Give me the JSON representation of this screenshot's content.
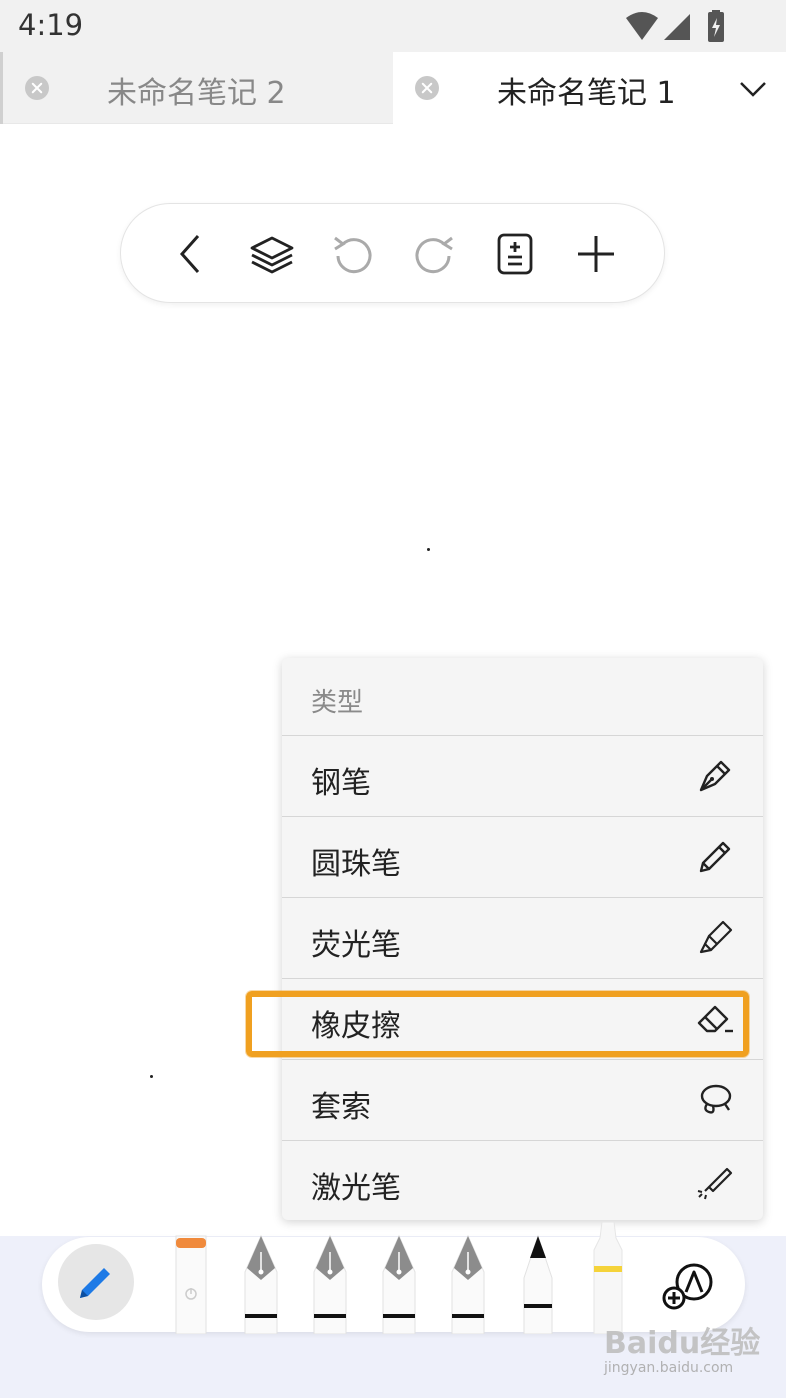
{
  "status_bar": {
    "time": "4:19"
  },
  "tabs": [
    {
      "title": "未命名笔记 2",
      "active": false
    },
    {
      "title": "未命名笔记 1",
      "active": true
    }
  ],
  "toolbar": {
    "icons": [
      "back-icon",
      "layers-icon",
      "undo-icon",
      "redo-icon",
      "page-add-icon",
      "plus-icon"
    ]
  },
  "menu": {
    "header": "类型",
    "items": [
      {
        "label": "钢笔",
        "icon": "fountain-pen-icon"
      },
      {
        "label": "圆珠笔",
        "icon": "pencil-icon"
      },
      {
        "label": "荧光笔",
        "icon": "highlighter-icon"
      },
      {
        "label": "橡皮擦",
        "icon": "eraser-icon",
        "highlighted": true
      },
      {
        "label": "套索",
        "icon": "lasso-icon"
      },
      {
        "label": "激光笔",
        "icon": "laser-pen-icon"
      }
    ]
  },
  "pen_tray": {
    "tools": [
      "eraser-stick-icon",
      "fountain-pen-icon",
      "fountain-pen-icon",
      "fountain-pen-icon",
      "fountain-pen-icon",
      "marker-icon",
      "highlighter-stick-icon"
    ],
    "accent_colors": {
      "pen_button": "#1e7ae6",
      "eraser_tip": "#f08a3c",
      "highlighter_band": "#f5d33a",
      "highlight_box": "#f0a020"
    }
  },
  "watermark": {
    "text": "Baidu经验",
    "sub": "jingyan.baidu.com"
  }
}
